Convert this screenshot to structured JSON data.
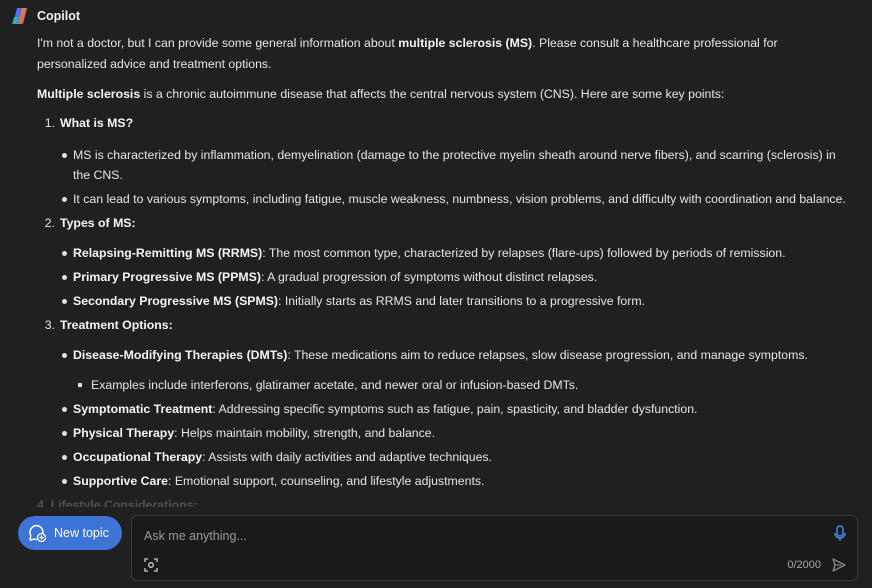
{
  "app": {
    "name": "Copilot"
  },
  "response": {
    "intro": {
      "before": "I'm not a doctor, but I can provide some general information about ",
      "bold": "multiple sclerosis (MS)",
      "after": ". Please consult a healthcare professional for personalized advice and treatment options."
    },
    "lead": {
      "bold": "Multiple sclerosis",
      "after": " is a chronic autoimmune disease that affects the central nervous system (CNS). Here are some key points:"
    },
    "sections": [
      {
        "num": "1.",
        "title": "What is MS?",
        "bullets": [
          {
            "bold": "",
            "text": "MS is characterized by inflammation, demyelination (damage to the protective myelin sheath around nerve fibers), and scarring (sclerosis) in the CNS."
          },
          {
            "bold": "",
            "text": "It can lead to various symptoms, including fatigue, muscle weakness, numbness, vision problems, and difficulty with coordination and balance."
          }
        ]
      },
      {
        "num": "2.",
        "title": "Types of MS:",
        "bullets": [
          {
            "bold": "Relapsing-Remitting MS (RRMS)",
            "text": ": The most common type, characterized by relapses (flare-ups) followed by periods of remission."
          },
          {
            "bold": "Primary Progressive MS (PPMS)",
            "text": ": A gradual progression of symptoms without distinct relapses."
          },
          {
            "bold": "Secondary Progressive MS (SPMS)",
            "text": ": Initially starts as RRMS and later transitions to a progressive form."
          }
        ]
      },
      {
        "num": "3.",
        "title": "Treatment Options:",
        "bullets": [
          {
            "bold": "Disease-Modifying Therapies (DMTs)",
            "text": ": These medications aim to reduce relapses, slow disease progression, and manage symptoms.",
            "sub": "Examples include interferons, glatiramer acetate, and newer oral or infusion-based DMTs."
          },
          {
            "bold": "Symptomatic Treatment",
            "text": ": Addressing specific symptoms such as fatigue, pain, spasticity, and bladder dysfunction."
          },
          {
            "bold": "Physical Therapy",
            "text": ": Helps maintain mobility, strength, and balance."
          },
          {
            "bold": "Occupational Therapy",
            "text": ": Assists with daily activities and adaptive techniques."
          },
          {
            "bold": "Supportive Care",
            "text": ": Emotional support, counseling, and lifestyle adjustments."
          }
        ]
      }
    ],
    "cut_off": "4. Lifestyle Considerations:"
  },
  "composer": {
    "new_topic_label": "New topic",
    "placeholder": "Ask me anything...",
    "counter": "0/2000"
  },
  "colors": {
    "background": "#202020",
    "accent": "#3e74d6",
    "text": "#e6e6e6"
  },
  "icons": [
    "copilot-logo",
    "new-topic-icon",
    "microphone-icon",
    "image-scan-icon",
    "send-icon"
  ]
}
